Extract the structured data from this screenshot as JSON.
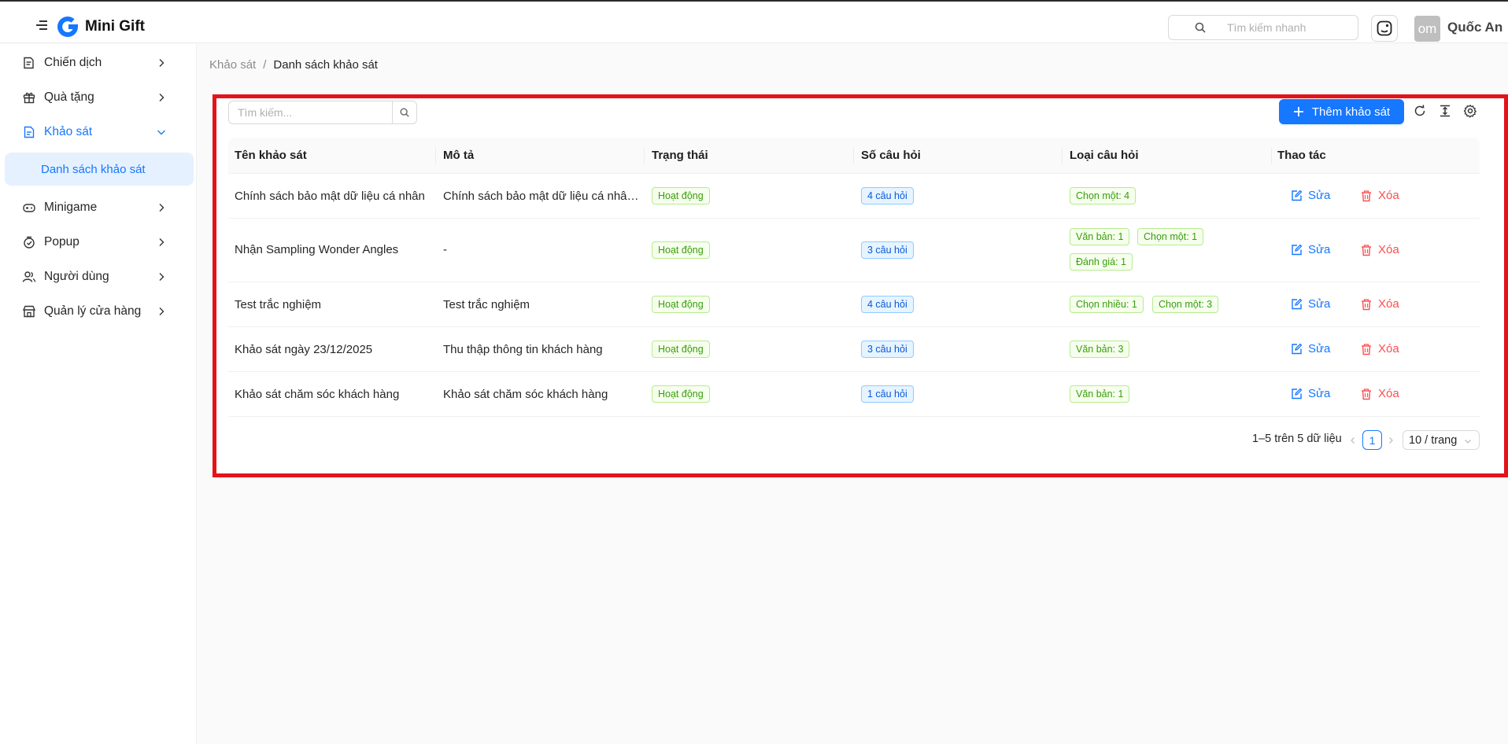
{
  "header": {
    "brand": "Mini Gift",
    "search_placeholder": "Tìm kiếm nhanh",
    "avatar_text": "om",
    "user_name": "Quốc An"
  },
  "sidebar": {
    "items": [
      {
        "label": "Chiến dịch",
        "icon": "campaign-icon"
      },
      {
        "label": "Quà tặng",
        "icon": "gift-icon"
      },
      {
        "label": "Khảo sát",
        "icon": "survey-icon",
        "expanded": true
      },
      {
        "label": "Minigame",
        "icon": "gamepad-icon"
      },
      {
        "label": "Popup",
        "icon": "popup-icon"
      },
      {
        "label": "Người dùng",
        "icon": "users-icon"
      },
      {
        "label": "Quản lý cửa hàng",
        "icon": "store-icon"
      }
    ],
    "sub_item": "Danh sách khảo sát"
  },
  "breadcrumb": {
    "parent": "Khảo sát",
    "separator": "/",
    "current": "Danh sách khảo sát"
  },
  "toolbar": {
    "search_placeholder": "Tìm kiếm...",
    "add_label": "Thêm khảo sát"
  },
  "table": {
    "columns": [
      "Tên khảo sát",
      "Mô tả",
      "Trạng thái",
      "Số câu hỏi",
      "Loại câu hỏi",
      "Thao tác"
    ],
    "rows": [
      {
        "name": "Chính sách bảo mật dữ liệu cá nhân",
        "description": "Chính sách bảo mật dữ liệu cá nhân khách hàng",
        "status": "Hoạt động",
        "question_count": "4 câu hỏi",
        "types": [
          "Chọn một: 4"
        ]
      },
      {
        "name": "Nhận Sampling Wonder Angles",
        "description": "-",
        "status": "Hoạt động",
        "question_count": "3 câu hỏi",
        "types": [
          "Văn bản: 1",
          "Chọn một: 1",
          "Đánh giá: 1"
        ]
      },
      {
        "name": "Test trắc nghiệm",
        "description": "Test trắc nghiệm",
        "status": "Hoạt động",
        "question_count": "4 câu hỏi",
        "types": [
          "Chọn nhiều: 1",
          "Chọn một: 3"
        ]
      },
      {
        "name": "Khảo sát ngày 23/12/2025",
        "description": "Thu thập thông tin khách hàng",
        "status": "Hoạt động",
        "question_count": "3 câu hỏi",
        "types": [
          "Văn bản: 3"
        ]
      },
      {
        "name": "Khảo sát chăm sóc khách hàng",
        "description": "Khảo sát chăm sóc khách hàng",
        "status": "Hoạt động",
        "question_count": "1 câu hỏi",
        "types": [
          "Văn bản: 1"
        ]
      }
    ],
    "edit_label": "Sửa",
    "delete_label": "Xóa"
  },
  "pagination": {
    "total_text": "1–5 trên 5 dữ liệu",
    "current_page": "1",
    "page_size": "10 / trang"
  },
  "colors": {
    "primary": "#1677ff",
    "danger": "#ff4d4f",
    "success": "#389e0d",
    "highlight_border": "#e4131a"
  }
}
